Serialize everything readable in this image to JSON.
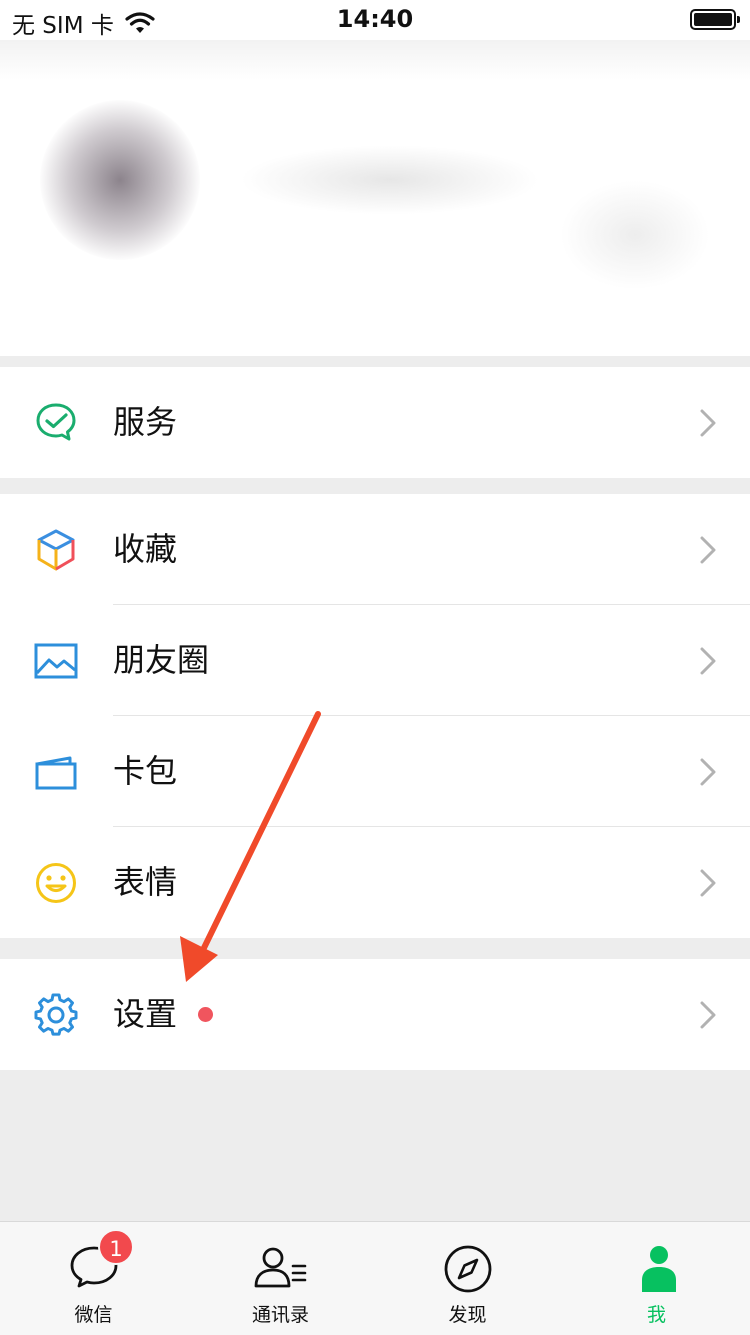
{
  "status_bar": {
    "carrier": "无 SIM 卡",
    "time": "14:40"
  },
  "menu": {
    "services": {
      "label": "服务"
    },
    "favorites": {
      "label": "收藏"
    },
    "moments": {
      "label": "朋友圈"
    },
    "cards": {
      "label": "卡包"
    },
    "stickers": {
      "label": "表情"
    },
    "settings": {
      "label": "设置",
      "has_red_dot": true
    }
  },
  "tabbar": {
    "tabs": [
      {
        "label": "微信",
        "icon": "chat-bubble-icon",
        "badge": "1",
        "active": false
      },
      {
        "label": "通讯录",
        "icon": "contacts-icon",
        "active": false
      },
      {
        "label": "发现",
        "icon": "compass-icon",
        "active": false
      },
      {
        "label": "我",
        "icon": "me-person-icon",
        "active": true
      }
    ]
  },
  "colors": {
    "active_green": "#07c160",
    "badge_red": "#f2494d",
    "dot_red": "#f0555e",
    "arrow_red": "#f04a2a"
  }
}
